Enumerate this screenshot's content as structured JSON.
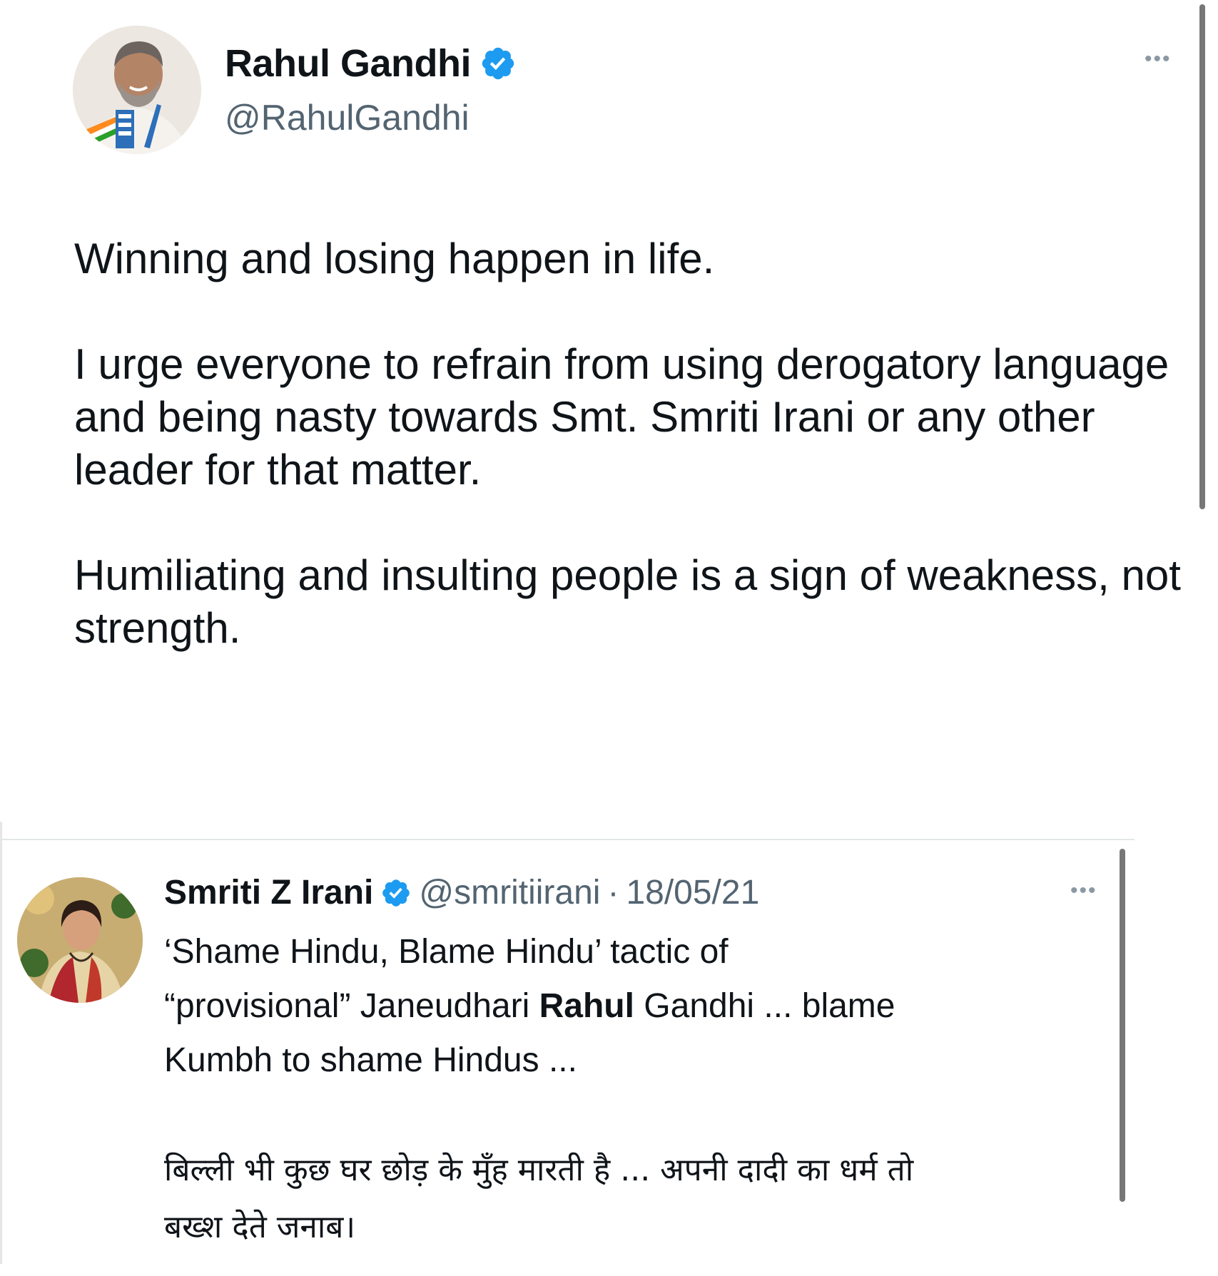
{
  "tweet_main": {
    "author_name": "Rahul Gandhi",
    "author_handle": "@RahulGandhi",
    "more_label": "•••",
    "paragraphs": [
      "Winning and losing happen in life.",
      "I urge everyone to refrain from using derogatory language and being nasty towards Smt. Smriti Irani or any other leader for that matter.",
      "Humiliating and insulting people is a sign of weakness, not strength."
    ]
  },
  "tweet_quoted": {
    "author_name": "Smriti Z Irani",
    "author_handle": "@smritiirani",
    "separator": "·",
    "date": "18/05/21",
    "more_label": "•••",
    "line1": "‘Shame Hindu, Blame Hindu’ tactic of",
    "line2_pre": "“provisional” Janeudhari ",
    "line2_bold": "Rahul",
    "line2_post": " Gandhi ... blame",
    "line3": "Kumbh to shame Hindus ...",
    "hindi_line1": "बिल्ली भी कुछ घर छोड़ के मुँह मारती है ... अपनी दादी का धर्म तो",
    "hindi_line2": "बख्श देते जनाब।"
  },
  "colors": {
    "verified_blue": "#1d9bf0",
    "text_primary": "#0f1419",
    "text_secondary": "#536471"
  },
  "icons": {
    "verified": "verified-badge-icon",
    "more": "more-options-icon"
  }
}
